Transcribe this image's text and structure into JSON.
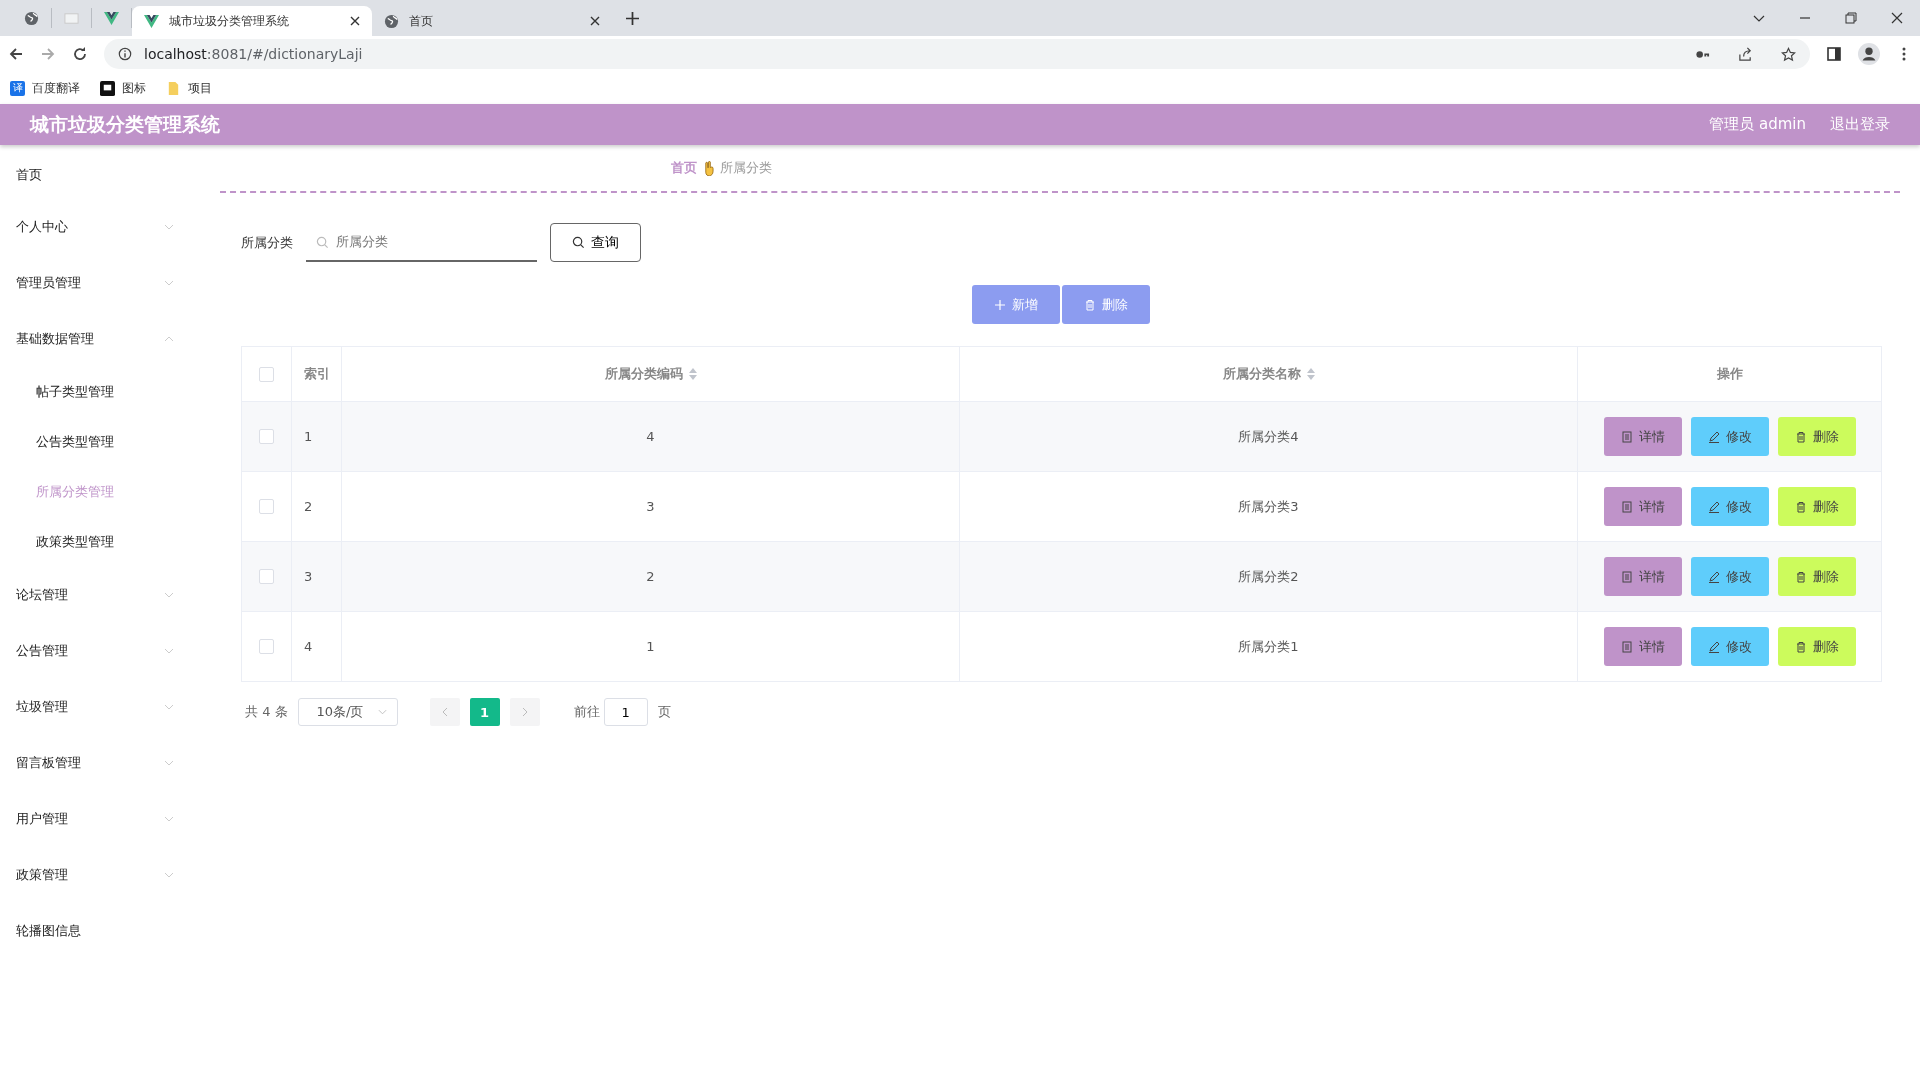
{
  "browser": {
    "tabs": [
      {
        "kind": "globe",
        "selected": false
      },
      {
        "kind": "blank",
        "selected": false
      },
      {
        "kind": "vue",
        "selected": false
      },
      {
        "kind": "vue",
        "label": "城市垃圾分类管理系统",
        "selected": true
      },
      {
        "kind": "globe",
        "label": "首页",
        "selected": false
      }
    ],
    "url_host": "localhost",
    "url_rest": ":8081/#/dictionaryLaji",
    "bookmarks": [
      {
        "kind": "translate",
        "label": "百度翻译",
        "badge": "译"
      },
      {
        "kind": "flag",
        "label": "图标"
      },
      {
        "kind": "folder",
        "label": "项目"
      }
    ]
  },
  "header": {
    "title": "城市垃圾分类管理系统",
    "user": "管理员 admin",
    "logout": "退出登录"
  },
  "sidebar": {
    "items": [
      {
        "label": "首页",
        "kind": "link",
        "selected": false
      },
      {
        "label": "个人中心",
        "kind": "group",
        "expanded": false,
        "selected": false
      },
      {
        "label": "管理员管理",
        "kind": "group",
        "expanded": false,
        "selected": false
      },
      {
        "label": "基础数据管理",
        "kind": "group",
        "expanded": true,
        "selected": false,
        "children": [
          {
            "label": "帖子类型管理",
            "selected": false
          },
          {
            "label": "公告类型管理",
            "selected": false
          },
          {
            "label": "所属分类管理",
            "selected": true
          },
          {
            "label": "政策类型管理",
            "selected": false
          }
        ]
      },
      {
        "label": "论坛管理",
        "kind": "group",
        "expanded": false,
        "selected": false
      },
      {
        "label": "公告管理",
        "kind": "group",
        "expanded": false,
        "selected": false
      },
      {
        "label": "垃圾管理",
        "kind": "group",
        "expanded": false,
        "selected": false
      },
      {
        "label": "留言板管理",
        "kind": "group",
        "expanded": false,
        "selected": false
      },
      {
        "label": "用户管理",
        "kind": "group",
        "expanded": false,
        "selected": false
      },
      {
        "label": "政策管理",
        "kind": "group",
        "expanded": false,
        "selected": false
      },
      {
        "label": "轮播图信息",
        "kind": "link",
        "selected": false
      }
    ]
  },
  "breadcrumb": [
    "首页",
    "所属分类"
  ],
  "search": {
    "label": "所属分类",
    "placeholder": "所属分类",
    "button": "查询"
  },
  "actions": [
    "新增",
    "删除"
  ],
  "table": {
    "all_checked": false,
    "columns": [
      "索引",
      "所属分类编码",
      "所属分类名称",
      "操作"
    ],
    "rows": [
      {
        "checked": false,
        "index": "1",
        "code": "4",
        "name": "所属分类4",
        "buttons": [
          {
            "kind": "detail",
            "label": "详情"
          },
          {
            "kind": "edit",
            "label": "修改"
          },
          {
            "kind": "delete",
            "label": "删除"
          }
        ]
      },
      {
        "checked": false,
        "index": "2",
        "code": "3",
        "name": "所属分类3",
        "buttons": [
          {
            "kind": "detail",
            "label": "详情"
          },
          {
            "kind": "edit",
            "label": "修改"
          },
          {
            "kind": "delete",
            "label": "删除"
          }
        ]
      },
      {
        "checked": false,
        "index": "3",
        "code": "2",
        "name": "所属分类2",
        "buttons": [
          {
            "kind": "detail",
            "label": "详情"
          },
          {
            "kind": "edit",
            "label": "修改"
          },
          {
            "kind": "delete",
            "label": "删除"
          }
        ]
      },
      {
        "checked": false,
        "index": "4",
        "code": "1",
        "name": "所属分类1",
        "buttons": [
          {
            "kind": "detail",
            "label": "详情"
          },
          {
            "kind": "edit",
            "label": "修改"
          },
          {
            "kind": "delete",
            "label": "删除"
          }
        ]
      }
    ]
  },
  "pagination": {
    "total": "共 4 条",
    "page_size": "10条/页",
    "pages": [
      {
        "label": "1",
        "selected": true
      }
    ],
    "goto_label": "前往",
    "goto_value": "1",
    "goto_suffix": "页"
  }
}
